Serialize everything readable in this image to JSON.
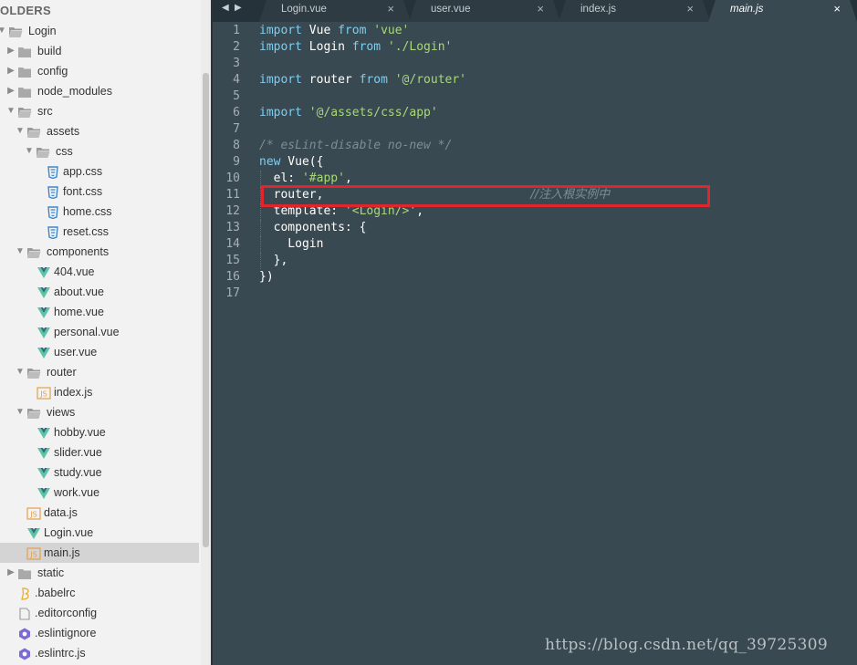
{
  "sidebar": {
    "header": "OLDERS",
    "tree": [
      {
        "label": "Login",
        "type": "folder-open",
        "depth": 0
      },
      {
        "label": "build",
        "type": "folder",
        "depth": 1
      },
      {
        "label": "config",
        "type": "folder",
        "depth": 1
      },
      {
        "label": "node_modules",
        "type": "folder",
        "depth": 1
      },
      {
        "label": "src",
        "type": "folder-open",
        "depth": 1
      },
      {
        "label": "assets",
        "type": "folder-open",
        "depth": 2
      },
      {
        "label": "css",
        "type": "folder-open",
        "depth": 3
      },
      {
        "label": "app.css",
        "type": "css",
        "depth": 4
      },
      {
        "label": "font.css",
        "type": "css",
        "depth": 4
      },
      {
        "label": "home.css",
        "type": "css",
        "depth": 4
      },
      {
        "label": "reset.css",
        "type": "css",
        "depth": 4
      },
      {
        "label": "components",
        "type": "folder-open",
        "depth": 2
      },
      {
        "label": "404.vue",
        "type": "vue",
        "depth": 3
      },
      {
        "label": "about.vue",
        "type": "vue",
        "depth": 3
      },
      {
        "label": "home.vue",
        "type": "vue",
        "depth": 3
      },
      {
        "label": "personal.vue",
        "type": "vue",
        "depth": 3
      },
      {
        "label": "user.vue",
        "type": "vue",
        "depth": 3
      },
      {
        "label": "router",
        "type": "folder-open",
        "depth": 2
      },
      {
        "label": "index.js",
        "type": "js",
        "depth": 3
      },
      {
        "label": "views",
        "type": "folder-open",
        "depth": 2
      },
      {
        "label": "hobby.vue",
        "type": "vue",
        "depth": 3
      },
      {
        "label": "slider.vue",
        "type": "vue",
        "depth": 3
      },
      {
        "label": "study.vue",
        "type": "vue",
        "depth": 3
      },
      {
        "label": "work.vue",
        "type": "vue",
        "depth": 3
      },
      {
        "label": "data.js",
        "type": "js",
        "depth": 2
      },
      {
        "label": "Login.vue",
        "type": "vue",
        "depth": 2
      },
      {
        "label": "main.js",
        "type": "js",
        "depth": 2,
        "selected": true
      },
      {
        "label": "static",
        "type": "folder",
        "depth": 1
      },
      {
        "label": ".babelrc",
        "type": "babel",
        "depth": 1
      },
      {
        "label": ".editorconfig",
        "type": "file",
        "depth": 1
      },
      {
        "label": ".eslintignore",
        "type": "eslint",
        "depth": 1
      },
      {
        "label": ".eslintrc.js",
        "type": "eslint",
        "depth": 1
      }
    ]
  },
  "tabs": [
    {
      "label": "Login.vue",
      "close": "×",
      "active": false
    },
    {
      "label": "user.vue",
      "close": "×",
      "active": false
    },
    {
      "label": "index.js",
      "close": "×",
      "active": false
    },
    {
      "label": "main.js",
      "close": "×",
      "active": true
    }
  ],
  "nav": {
    "back": "◀",
    "forward": "▶"
  },
  "code": [
    {
      "n": "1",
      "tokens": [
        [
          "kw",
          "import"
        ],
        [
          "pun",
          " Vue "
        ],
        [
          "kw",
          "from"
        ],
        [
          "pun",
          " "
        ],
        [
          "str",
          "'vue'"
        ]
      ]
    },
    {
      "n": "2",
      "tokens": [
        [
          "kw",
          "import"
        ],
        [
          "pun",
          " Login "
        ],
        [
          "kw",
          "from"
        ],
        [
          "pun",
          " "
        ],
        [
          "str",
          "'./Login'"
        ]
      ]
    },
    {
      "n": "3",
      "tokens": []
    },
    {
      "n": "4",
      "tokens": [
        [
          "kw",
          "import"
        ],
        [
          "pun",
          " router "
        ],
        [
          "kw",
          "from"
        ],
        [
          "pun",
          " "
        ],
        [
          "str",
          "'@/router'"
        ]
      ]
    },
    {
      "n": "5",
      "tokens": []
    },
    {
      "n": "6",
      "tokens": [
        [
          "kw",
          "import"
        ],
        [
          "pun",
          " "
        ],
        [
          "str",
          "'@/assets/css/app'"
        ]
      ]
    },
    {
      "n": "7",
      "tokens": []
    },
    {
      "n": "8",
      "tokens": [
        [
          "cmt",
          "/* esLint-disable no-new */"
        ]
      ]
    },
    {
      "n": "9",
      "tokens": [
        [
          "kw",
          "new"
        ],
        [
          "pun",
          " Vue({"
        ]
      ]
    },
    {
      "n": "10",
      "tokens": [
        [
          "pun",
          "  el: "
        ],
        [
          "str",
          "'#app'"
        ],
        [
          "pun",
          ","
        ]
      ],
      "guide": true
    },
    {
      "n": "11",
      "tokens": [
        [
          "pun",
          "  router,                             "
        ],
        [
          "cmt",
          "//注入根实例中"
        ]
      ],
      "guide": true
    },
    {
      "n": "12",
      "tokens": [
        [
          "pun",
          "  template: "
        ],
        [
          "str",
          "'<Login/>'"
        ],
        [
          "pun",
          ","
        ]
      ],
      "guide": true
    },
    {
      "n": "13",
      "tokens": [
        [
          "pun",
          "  components: {"
        ]
      ],
      "guide": true
    },
    {
      "n": "14",
      "tokens": [
        [
          "pun",
          "    Login"
        ]
      ],
      "guide": true
    },
    {
      "n": "15",
      "tokens": [
        [
          "pun",
          "  },"
        ]
      ],
      "guide": true
    },
    {
      "n": "16",
      "tokens": [
        [
          "pun",
          "})"
        ]
      ]
    },
    {
      "n": "17",
      "tokens": []
    }
  ],
  "watermark": "https://blog.csdn.net/qq_39725309",
  "colors": {
    "highlight": "#e0262d",
    "editor_bg": "#394951",
    "keyword": "#7fcdf0",
    "string": "#a8d879"
  }
}
